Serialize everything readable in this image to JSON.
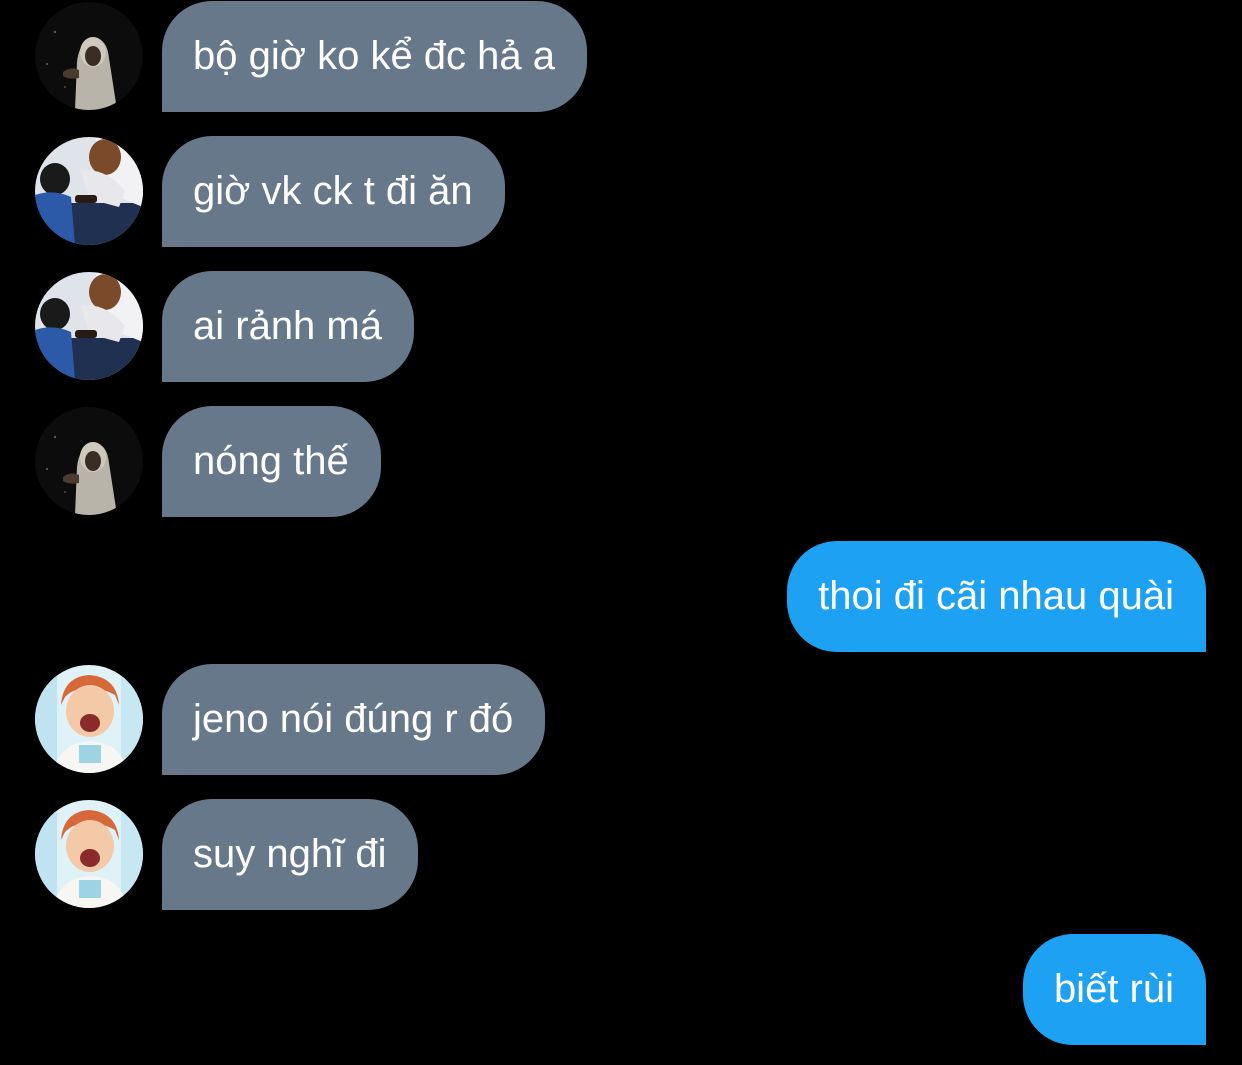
{
  "conversation": {
    "messages": [
      {
        "sender": "incoming",
        "avatar": "hooded-user-avatar",
        "text": "bộ giờ ko kể đc hả a"
      },
      {
        "sender": "incoming",
        "avatar": "two-people-avatar",
        "text": "giờ vk ck t đi ăn"
      },
      {
        "sender": "incoming",
        "avatar": "two-people-avatar",
        "text": "ai rảnh má"
      },
      {
        "sender": "incoming",
        "avatar": "hooded-user-avatar",
        "text": "nóng thế"
      },
      {
        "sender": "outgoing",
        "text": "thoi đi cãi nhau quài"
      },
      {
        "sender": "incoming",
        "avatar": "smiling-boy-avatar",
        "text": "jeno nói đúng r đó"
      },
      {
        "sender": "incoming",
        "avatar": "smiling-boy-avatar",
        "text": "suy nghĩ đi"
      },
      {
        "sender": "outgoing",
        "text": "biết rùi"
      }
    ]
  },
  "colors": {
    "background": "#000000",
    "incoming_bubble": "#66788a",
    "outgoing_bubble": "#1da1f2",
    "bubble_text": "#ffffff"
  }
}
